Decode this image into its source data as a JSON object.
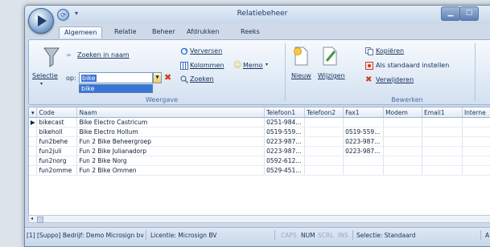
{
  "window": {
    "title": "Relatiebeheer",
    "min_glyph": "▁",
    "max_glyph": "▢"
  },
  "quick_access": {
    "dropdown_glyph": "▾",
    "icon_glyph": "⟳"
  },
  "tabs": [
    {
      "label": "Algemeen",
      "active": true
    },
    {
      "label": "Relatie"
    },
    {
      "label": "Beheer"
    },
    {
      "label": "Afdrukken"
    },
    {
      "label": "Reeks"
    }
  ],
  "ribbon": {
    "weergave": {
      "zoeken_in_naam": "Zoeken in naam",
      "selectie": "Selectie",
      "op": "op:",
      "search_value": "bike",
      "dropdown_option": "bike",
      "verversen": "Verversen",
      "kolommen": "Kolommen",
      "memo": "Memo",
      "zoeken": "Zoeken",
      "group_label": "Weergave"
    },
    "bewerken": {
      "nieuw": "Nieuw",
      "wijzigen": "Wijzigen",
      "kopieren": "Kopiëren",
      "als_standaard": "Als standaard instellen",
      "verwijderen": "Verwijderen",
      "group_label": "Bewerken"
    }
  },
  "grid": {
    "columns": [
      "Code",
      "Naam",
      "Telefoon1",
      "Telefoon2",
      "Fax1",
      "Modem",
      "Email1",
      "Interne"
    ],
    "rows": [
      [
        "bikecast",
        "Bike Electro Castricum",
        "0251-984...",
        "",
        "",
        "",
        "",
        ""
      ],
      [
        "bikeholl",
        "Bike Electro Hollum",
        "0519-559...",
        "",
        "0519-559...",
        "",
        "",
        ""
      ],
      [
        "fun2behe",
        "Fun 2 Bike Beheergroep",
        "0223-987...",
        "",
        "0223-987...",
        "",
        "",
        ""
      ],
      [
        "fun2juli",
        "Fun 2 Bike Julianadorp",
        "0223-987...",
        "",
        "0223-987...",
        "",
        "",
        ""
      ],
      [
        "fun2norg",
        "Fun 2 Bike Norg",
        "0592-612...",
        "",
        "",
        "",
        "",
        ""
      ],
      [
        "fun2omme",
        "Fun 2 Bike Ommen",
        "0529-451...",
        "",
        "",
        "",
        "",
        ""
      ]
    ],
    "current_row": 0
  },
  "status": {
    "user": "[1] [Suppo] Bedrijf: Demo Microsign bv",
    "licentie": "Licentie: Microsign BV",
    "caps": "CAPS",
    "num": "NUM",
    "scrl": "SCRL",
    "ins": "INS",
    "selectie": "Selectie: Standaard",
    "tail": "A"
  },
  "colors": {
    "accent": "#3875d7",
    "delete_red": "#d23a1c",
    "frame": "#6d87ad"
  }
}
